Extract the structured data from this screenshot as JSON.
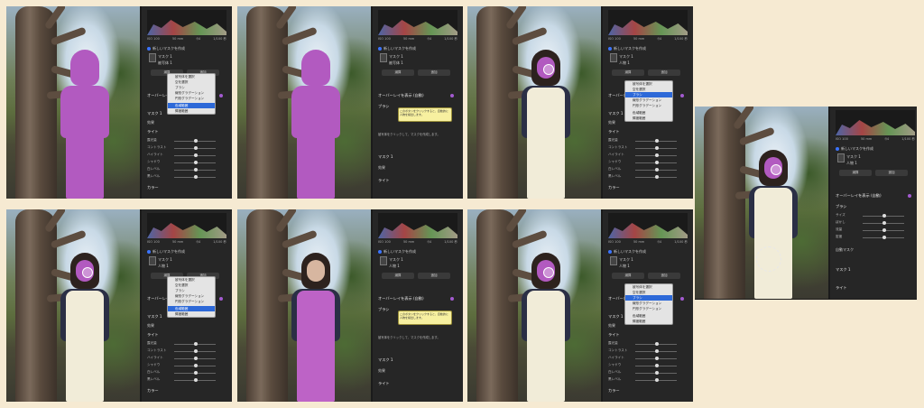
{
  "exif": [
    "ISO 100",
    "50 mm",
    "f/4",
    "1/100 秒"
  ],
  "panel": {
    "mask_group_title": "新しいマスクを作成",
    "mask_name": "マスク 1",
    "subject_label": "被写体 1",
    "person_label": "人物 1",
    "subtract_button": "減算",
    "add_button": "追加",
    "edit_section": "オーバーレイを表示 (自動)",
    "brush_label": "ブラシ",
    "size_label": "サイズ",
    "feather_label": "ぼかし",
    "flow_label": "流量",
    "density_label": "密度",
    "auto_mask_label": "自動マスク",
    "mask_preset_label": "マスク 1",
    "preset_label": "効果",
    "light_section": "ライト",
    "light_value": "0.00",
    "sliders": [
      "露光量",
      "コントラスト",
      "ハイライト",
      "シャドウ",
      "白レベル",
      "黒レベル"
    ],
    "color_section": "カラー",
    "help_text": "被写体をクリックして、マスクを作成します。"
  },
  "menu": {
    "items": [
      "被写体を選択",
      "空を選択",
      "ブラシ",
      "線形グラデーション",
      "円形グラデーション",
      "色域範囲",
      "輝度範囲"
    ],
    "selected_top": "色域範囲",
    "selected_bottom": "ブラシ"
  },
  "tooltip": "このボタンをクリックすると、自動的に人物を検出します。"
}
